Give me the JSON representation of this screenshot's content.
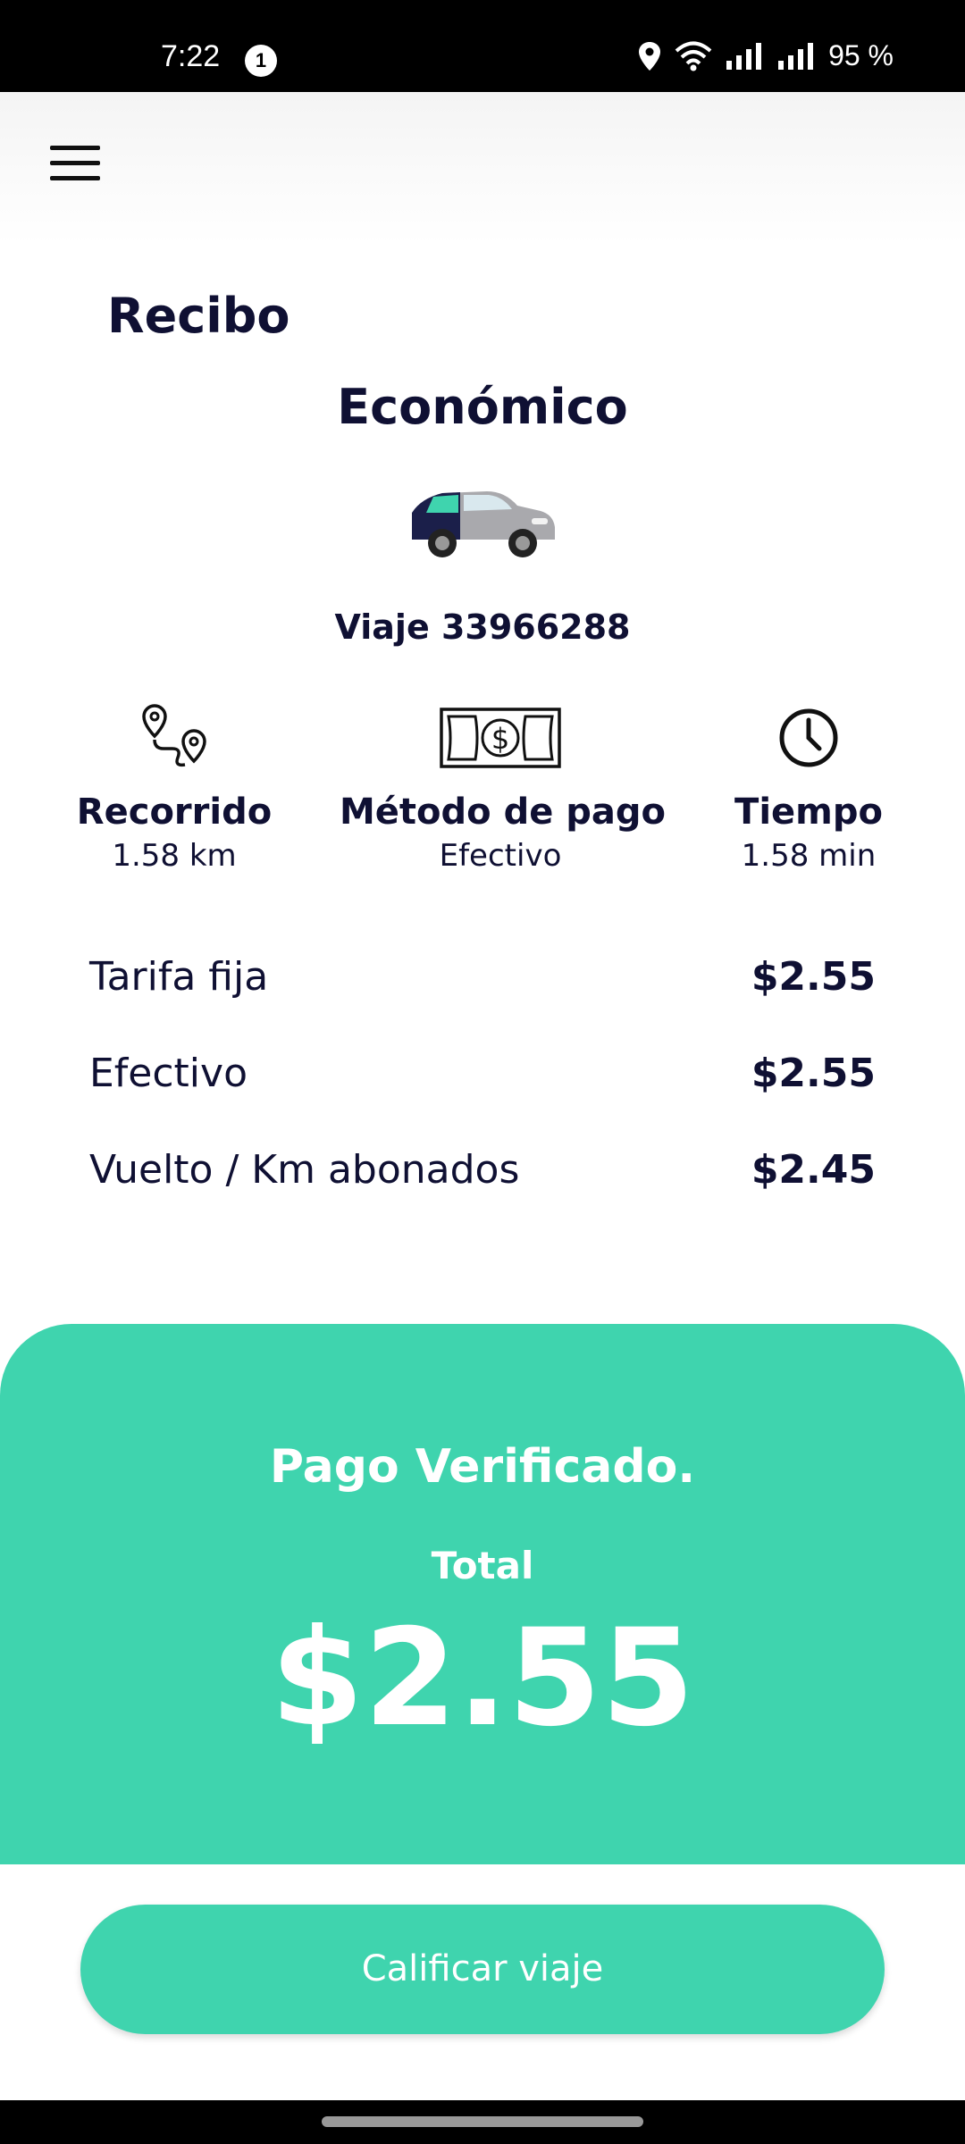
{
  "status_bar": {
    "time": "7:22",
    "notification_count": "1",
    "battery": "95 %"
  },
  "receipt": {
    "title": "Recibo",
    "category": "Económico",
    "trip_id": "Viaje 33966288"
  },
  "stats": {
    "distance": {
      "label": "Recorrido",
      "value": "1.58 km",
      "icon": "route-pins-icon"
    },
    "payment": {
      "label": "Método de pago",
      "value": "Efectivo",
      "icon": "banknote-icon"
    },
    "time": {
      "label": "Tiempo",
      "value": "1.58 min",
      "icon": "clock-icon"
    }
  },
  "fares": [
    {
      "label": "Tarifa fija",
      "amount": "$2.55"
    },
    {
      "label": "Efectivo",
      "amount": "$2.55"
    },
    {
      "label": "Vuelto / Km abonados",
      "amount": "$2.45"
    }
  ],
  "total_panel": {
    "status": "Pago Verificado.",
    "total_label": "Total",
    "total_amount": "$2.55"
  },
  "actions": {
    "rate_trip": "Calificar viaje"
  },
  "colors": {
    "accent": "#3fd4ae",
    "text": "#0f1033"
  }
}
